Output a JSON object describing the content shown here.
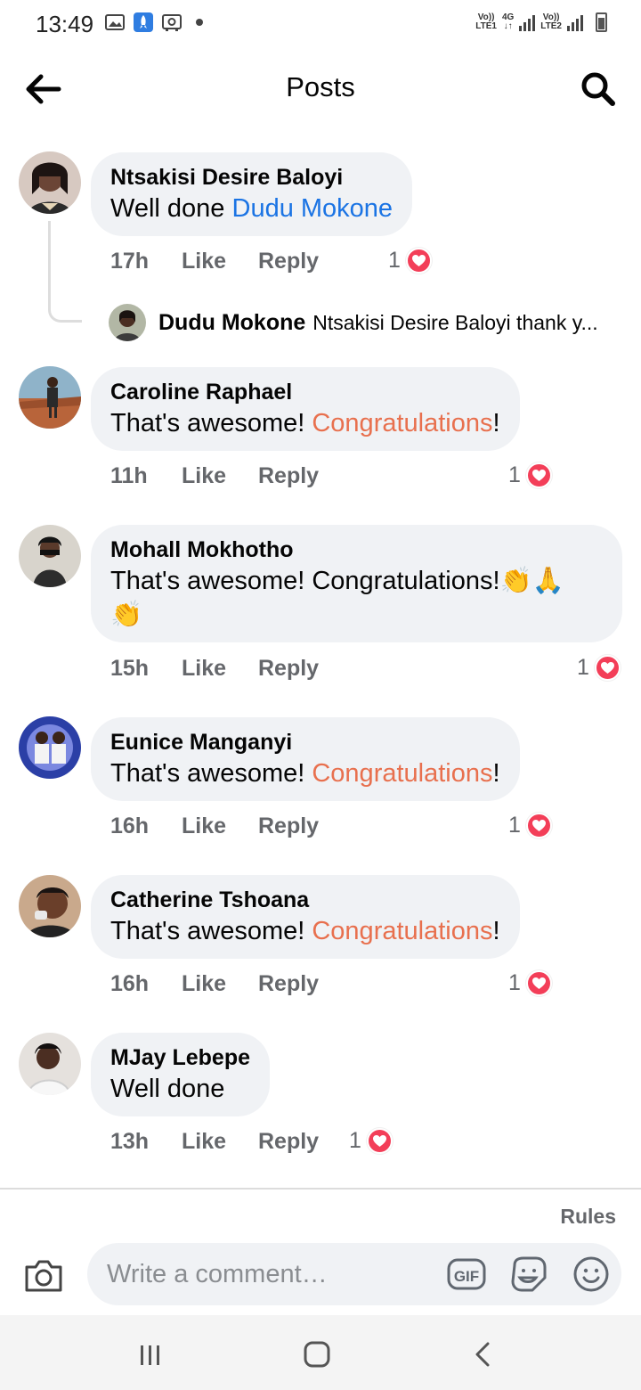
{
  "status_bar": {
    "time": "13:49",
    "net1_top": "Vo))",
    "net1_bottom": "LTE1",
    "net_type": "4G",
    "net2_top": "Vo))",
    "net2_bottom": "LTE2"
  },
  "header": {
    "title": "Posts"
  },
  "comments": [
    {
      "name": "Ntsakisi Desire Baloyi",
      "text_parts": [
        "Well done ",
        "Dudu Mokone"
      ],
      "time": "17h",
      "like_label": "Like",
      "reply_label": "Reply",
      "reaction_count": "1"
    },
    {
      "name": "Caroline Raphael",
      "text_parts": [
        "That's awesome! ",
        "Congratulations",
        "!"
      ],
      "time": "11h",
      "like_label": "Like",
      "reply_label": "Reply",
      "reaction_count": "1"
    },
    {
      "name": "Mohall Mokhotho",
      "text_line1": "That's awesome! Congratulations!👏🙏",
      "text_line2": "👏",
      "time": "15h",
      "like_label": "Like",
      "reply_label": "Reply",
      "reaction_count": "1"
    },
    {
      "name": "Eunice Manganyi",
      "text_parts": [
        "That's awesome! ",
        "Congratulations",
        "!"
      ],
      "time": "16h",
      "like_label": "Like",
      "reply_label": "Reply",
      "reaction_count": "1"
    },
    {
      "name": "Catherine Tshoana",
      "text_parts": [
        "That's awesome! ",
        "Congratulations",
        "!"
      ],
      "time": "16h",
      "like_label": "Like",
      "reply_label": "Reply",
      "reaction_count": "1"
    },
    {
      "name": "MJay Lebepe",
      "text_parts": [
        "Well done"
      ],
      "time": "13h",
      "like_label": "Like",
      "reply_label": "Reply",
      "reaction_count": "1"
    }
  ],
  "reply": {
    "name": "Dudu Mokone",
    "text": "Ntsakisi Desire Baloyi thank y..."
  },
  "composer": {
    "rules_label": "Rules",
    "placeholder": "Write a comment…",
    "gif_label": "GIF"
  },
  "colors": {
    "mention": "#1b74e4",
    "hashtag": "#e8704e",
    "heart": "#f33e58",
    "bubble": "#f0f2f5",
    "meta": "#65676b"
  },
  "icons": [
    "back-arrow-icon",
    "search-icon",
    "heart-icon",
    "camera-icon",
    "gif-icon",
    "sticker-icon",
    "emoji-icon",
    "recents-icon",
    "home-icon",
    "nav-back-icon"
  ]
}
